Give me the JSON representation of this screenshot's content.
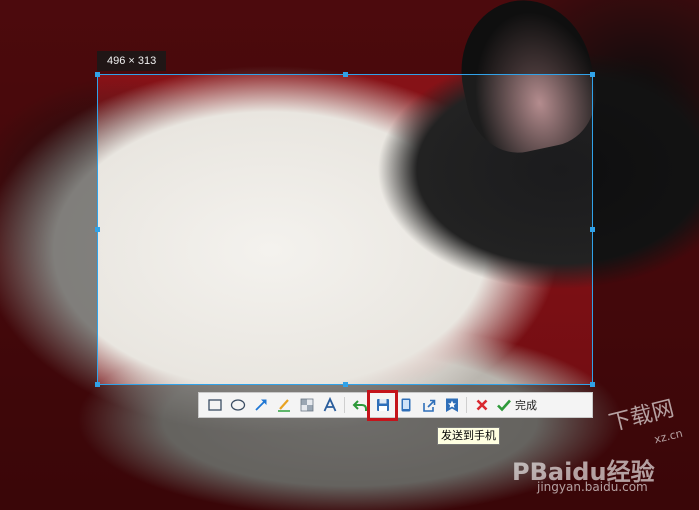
{
  "screenshot": {
    "size_label": "496 × 313",
    "selection_color": "#31a2e8"
  },
  "toolbar": {
    "tools": [
      {
        "name": "rectangle-tool",
        "icon": "rectangle-icon"
      },
      {
        "name": "ellipse-tool",
        "icon": "ellipse-icon"
      },
      {
        "name": "arrow-tool",
        "icon": "arrow-icon"
      },
      {
        "name": "pen-tool",
        "icon": "pen-icon"
      },
      {
        "name": "mosaic-tool",
        "icon": "mosaic-icon"
      },
      {
        "name": "text-tool",
        "icon": "text-icon"
      },
      {
        "name": "undo",
        "icon": "undo-icon"
      },
      {
        "name": "save",
        "icon": "save-icon"
      },
      {
        "name": "send-to-phone",
        "icon": "phone-icon"
      },
      {
        "name": "share",
        "icon": "share-icon"
      },
      {
        "name": "favorite",
        "icon": "star-icon"
      },
      {
        "name": "cancel",
        "icon": "close-icon"
      }
    ],
    "done_label": "完成",
    "highlight_color": "#c4141b"
  },
  "tooltip": {
    "text": "发送到手机"
  },
  "watermark": {
    "site_line1": "下载网",
    "site_line2": "xz.cn",
    "brand": "PBaidu经验",
    "url": "jingyan.baidu.com"
  }
}
